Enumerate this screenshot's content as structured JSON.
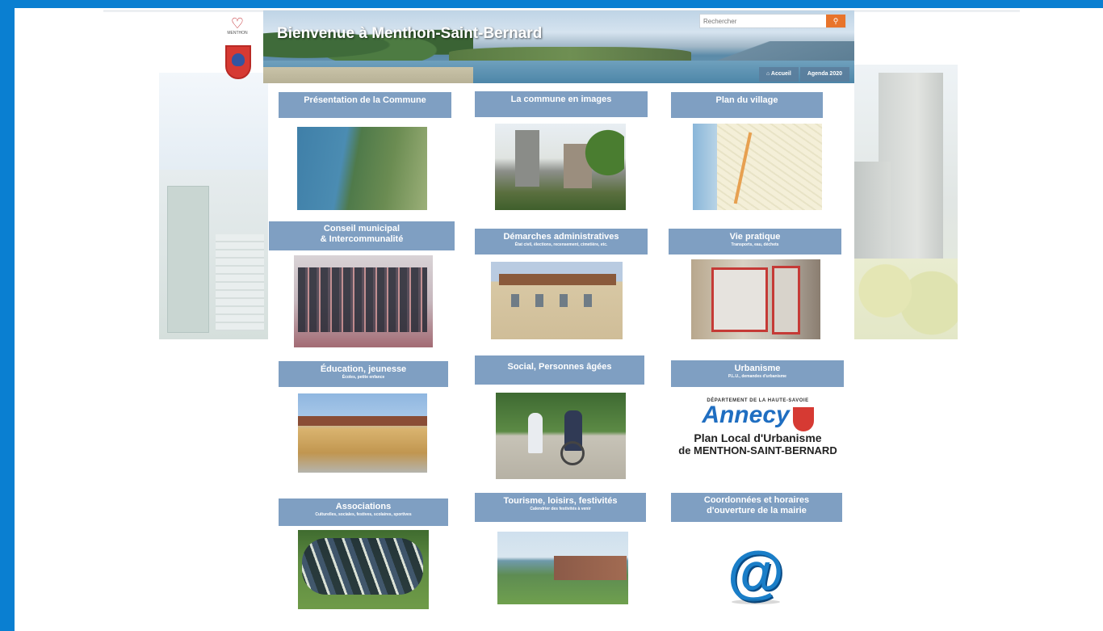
{
  "banner": {
    "title": "Bienvenue à Menthon-Saint-Bernard",
    "search_placeholder": "Rechercher",
    "nav": [
      "Accueil",
      "Agenda 2020"
    ]
  },
  "tiles": [
    {
      "title": "Présentation de la Commune",
      "subtitle": ""
    },
    {
      "title": "La commune en images",
      "subtitle": ""
    },
    {
      "title": "Plan du village",
      "subtitle": ""
    },
    {
      "title": "Conseil municipal",
      "title2": "& Intercommunalité",
      "subtitle": ""
    },
    {
      "title": "Démarches administratives",
      "subtitle": "État civil, élections, recensement, cimetière, etc."
    },
    {
      "title": "Vie pratique",
      "subtitle": "Transports, eau, déchets"
    },
    {
      "title": "Éducation, jeunesse",
      "subtitle": "Écoles, petite enfance"
    },
    {
      "title": "Social, Personnes âgées",
      "subtitle": ""
    },
    {
      "title": "Urbanisme",
      "subtitle": "P.L.U., demandes d'urbanisme"
    },
    {
      "title": "Associations",
      "subtitle": "Culturelles, sociales, festives, scolaires, sportives"
    },
    {
      "title": "Tourisme, loisirs, festivités",
      "subtitle": "Calendrier des festivités à venir"
    },
    {
      "title": "Coordonnées et horaires",
      "title2": "d'ouverture de la mairie",
      "subtitle": ""
    }
  ],
  "plu": {
    "dept": "DÉPARTEMENT DE LA HAUTE-SAVOIE",
    "brand": "Annecy",
    "line1": "Plan Local d'Urbanisme",
    "line2": "de MENTHON-SAINT-BERNARD"
  },
  "logo": {
    "heart": "♡",
    "text": "MENTHON"
  },
  "icons": {
    "search": "search-icon",
    "home": "home-icon",
    "at": "at-icon"
  },
  "colors": {
    "accent": "#0a7fd1",
    "tile": "#7f9fc2",
    "search_btn": "#e8742b"
  }
}
